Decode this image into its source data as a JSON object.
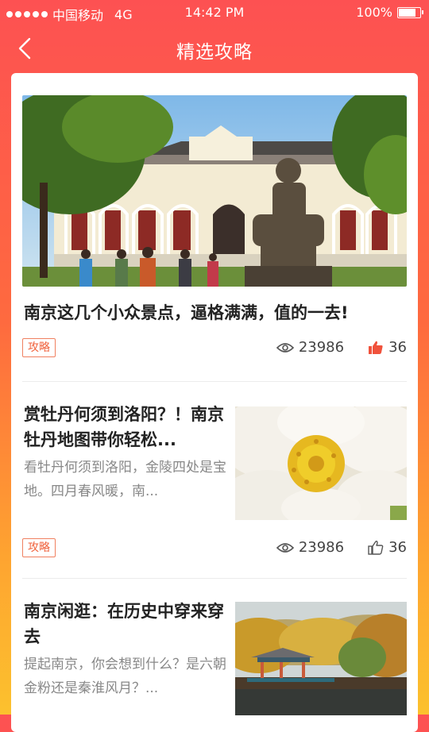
{
  "status_bar": {
    "carrier": "中国移动",
    "network": "4G",
    "time": "14:42 PM",
    "battery": "100%"
  },
  "nav": {
    "title": "精选攻略",
    "back_icon": "chevron-left-icon"
  },
  "articles": [
    {
      "title": "南京这几个小众景点，逼格满满，值的一去!",
      "tag": "攻略",
      "views": "23986",
      "likes": "36",
      "liked": true,
      "image": "statue-building-photo"
    },
    {
      "title": "赏牡丹何须到洛阳？！南京牡丹地图带你轻松...",
      "summary": "看牡丹何须到洛阳，金陵四处是宝地。四月春风暖，南...",
      "tag": "攻略",
      "views": "23986",
      "likes": "36",
      "liked": false,
      "image": "peony-flower-photo"
    },
    {
      "title": "南京闲逛：在历史中穿来穿去",
      "summary": "提起南京，你会想到什么？是六朝金粉还是秦淮风月？...",
      "image": "lake-pavilion-photo"
    }
  ],
  "colors": {
    "accent_red": "#f0523c",
    "gradient_top": "#fd5152",
    "gradient_bottom": "#fcc12e"
  }
}
